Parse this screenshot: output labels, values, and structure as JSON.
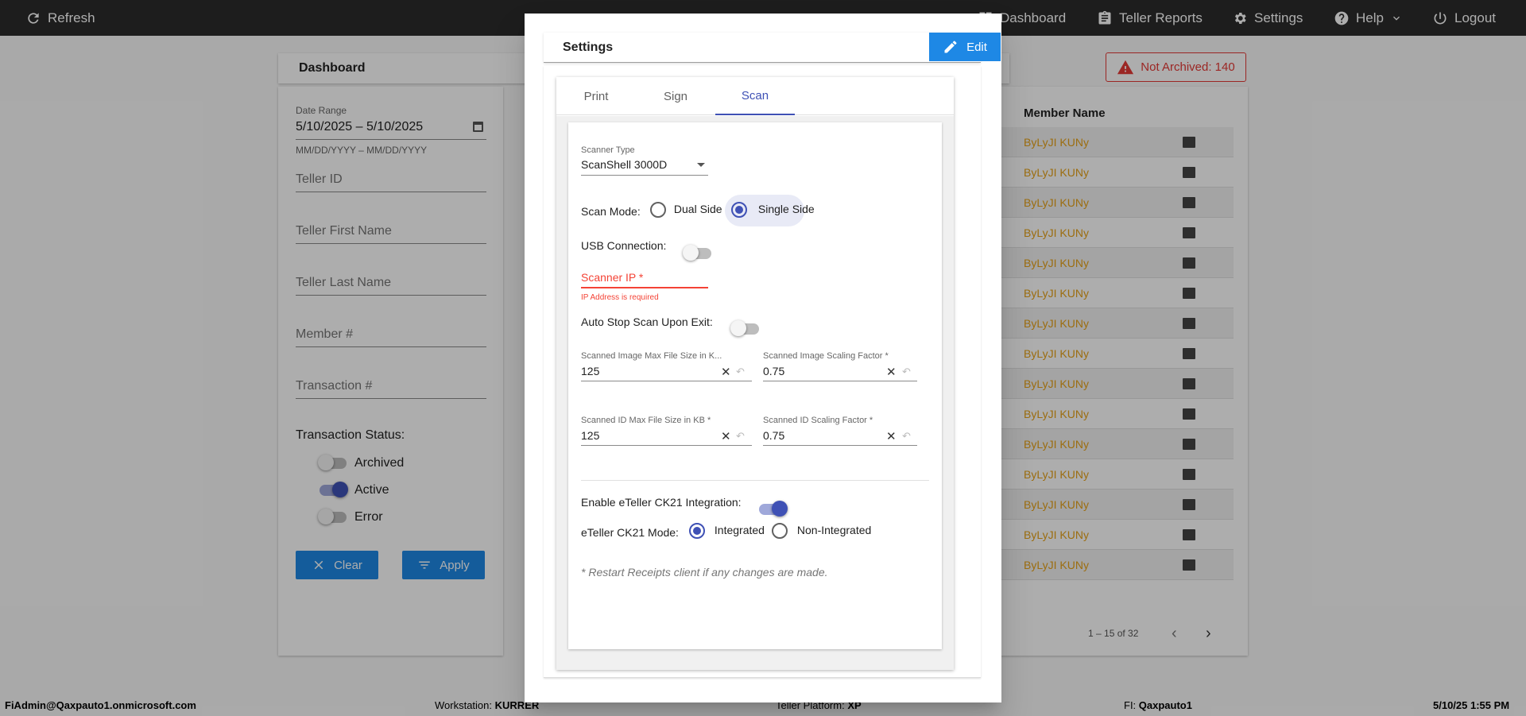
{
  "nav": {
    "refresh": "Refresh",
    "dashboard": "Dashboard",
    "teller_reports": "Teller Reports",
    "settings": "Settings",
    "help": "Help",
    "logout": "Logout"
  },
  "dashboard": {
    "title": "Dashboard",
    "not_archived": "Not Archived: 140",
    "filters": {
      "date_range_label": "Date Range",
      "date_range_value": "5/10/2025 – 5/10/2025",
      "date_range_hint": "MM/DD/YYYY – MM/DD/YYYY",
      "teller_id": "Teller ID",
      "teller_first_name": "Teller First Name",
      "teller_last_name": "Teller Last Name",
      "member_number": "Member #",
      "transaction_number": "Transaction #",
      "transaction_status_label": "Transaction Status:",
      "statuses": [
        {
          "label": "Archived",
          "on": false
        },
        {
          "label": "Active",
          "on": true
        },
        {
          "label": "Error",
          "on": false
        }
      ],
      "clear_label": "Clear",
      "apply_label": "Apply"
    },
    "table": {
      "member_name_header": "Member Name",
      "rows": [
        "ByLyJI KUNy",
        "ByLyJI KUNy",
        "ByLyJI KUNy",
        "ByLyJI KUNy",
        "ByLyJI KUNy",
        "ByLyJI KUNy",
        "ByLyJI KUNy",
        "ByLyJI KUNy",
        "ByLyJI KUNy",
        "ByLyJI KUNy",
        "ByLyJI KUNy",
        "ByLyJI KUNy",
        "ByLyJI KUNy",
        "ByLyJI KUNy",
        "ByLyJI KUNy"
      ],
      "pagination": "1 – 15 of 32"
    }
  },
  "footer": {
    "user": "FiAdmin@Qaxpauto1.onmicrosoft.com",
    "workstation_label": "Workstation:",
    "workstation": "KURRER",
    "platform_label": "Teller Platform:",
    "platform": "XP",
    "fi_label": "FI:",
    "fi": "Qaxpauto1",
    "datetime": "5/10/25 1:55 PM"
  },
  "modal": {
    "title": "Settings",
    "edit_label": "Edit",
    "tabs": [
      {
        "label": "Print",
        "active": false
      },
      {
        "label": "Sign",
        "active": false
      },
      {
        "label": "Scan",
        "active": true
      }
    ],
    "scan": {
      "scanner_type_label": "Scanner Type",
      "scanner_type_value": "ScanShell 3000D",
      "scan_mode_label": "Scan Mode:",
      "scan_mode_options": [
        "Dual Side",
        "Single Side"
      ],
      "scan_mode_selected": "Single Side",
      "usb_label": "USB Connection:",
      "usb_on": false,
      "scanner_ip_label": "Scanner IP *",
      "scanner_ip_error": "IP Address is required",
      "auto_stop_label": "Auto Stop Scan Upon Exit:",
      "auto_stop_on": false,
      "img_max_label": "Scanned Image Max File Size in K...",
      "img_max_value": "125",
      "img_scale_label": "Scanned Image Scaling Factor *",
      "img_scale_value": "0.75",
      "id_max_label": "Scanned ID Max File Size in KB *",
      "id_max_value": "125",
      "id_scale_label": "Scanned ID Scaling Factor *",
      "id_scale_value": "0.75",
      "ck21_label": "Enable eTeller CK21 Integration:",
      "ck21_on": true,
      "ck21_mode_label": "eTeller CK21 Mode:",
      "ck21_mode_options": [
        "Integrated",
        "Non-Integrated"
      ],
      "ck21_mode_selected": "Integrated",
      "restart_note": "* Restart Receipts client if any changes are made."
    }
  }
}
